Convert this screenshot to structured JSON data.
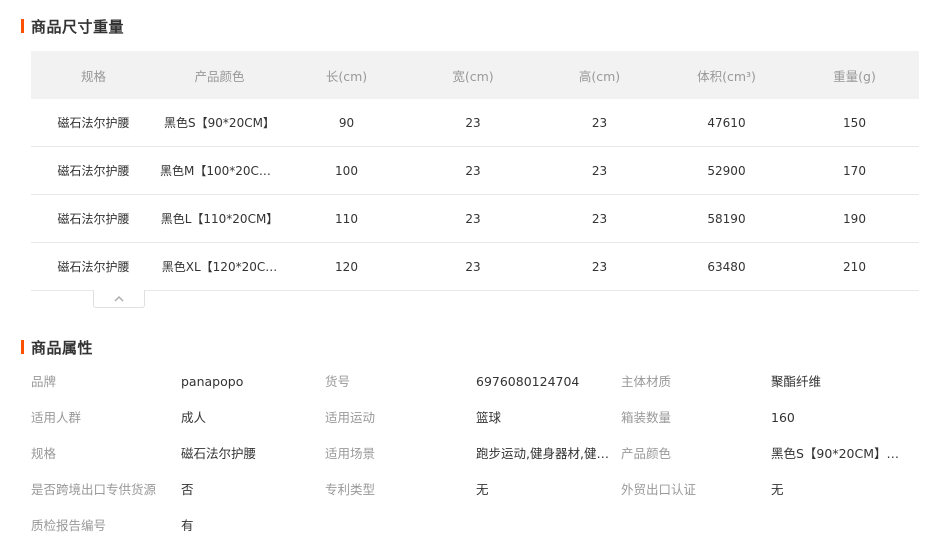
{
  "size_section": {
    "title": "商品尺寸重量",
    "headers": [
      "规格",
      "产品颜色",
      "长(cm)",
      "宽(cm)",
      "高(cm)",
      "体积(cm³)",
      "重量(g)"
    ],
    "rows": [
      [
        "磁石法尔护腰",
        "黑色S【90*20CM】",
        "90",
        "23",
        "23",
        "47610",
        "150"
      ],
      [
        "磁石法尔护腰",
        "黑色M【100*20CM…",
        "100",
        "23",
        "23",
        "52900",
        "170"
      ],
      [
        "磁石法尔护腰",
        "黑色L【110*20CM】",
        "110",
        "23",
        "23",
        "58190",
        "190"
      ],
      [
        "磁石法尔护腰",
        "黑色XL【120*20C…",
        "120",
        "23",
        "23",
        "63480",
        "210"
      ]
    ],
    "collapse_icon": "chevron-up-icon"
  },
  "attr_section": {
    "title": "商品属性",
    "rows": [
      [
        {
          "label": "品牌",
          "value": "panapopo"
        },
        {
          "label": "货号",
          "value": "6976080124704"
        },
        {
          "label": "主体材质",
          "value": "聚酯纤维"
        }
      ],
      [
        {
          "label": "适用人群",
          "value": "成人"
        },
        {
          "label": "适用运动",
          "value": "篮球"
        },
        {
          "label": "箱装数量",
          "value": "160"
        }
      ],
      [
        {
          "label": "规格",
          "value": "磁石法尔护腰"
        },
        {
          "label": "适用场景",
          "value": "跑步运动,健身器材,健…"
        },
        {
          "label": "产品颜色",
          "value": "黑色S【90*20CM】,…"
        }
      ],
      [
        {
          "label": "是否跨境出口专供货源",
          "value": "否"
        },
        {
          "label": "专利类型",
          "value": "无"
        },
        {
          "label": "外贸出口认证",
          "value": "无"
        }
      ],
      [
        {
          "label": "质检报告编号",
          "value": "有"
        }
      ]
    ]
  },
  "colors": {
    "accent": "#ff5000",
    "header_bg": "#f2f2f2",
    "label": "#999999",
    "text": "#333333"
  }
}
